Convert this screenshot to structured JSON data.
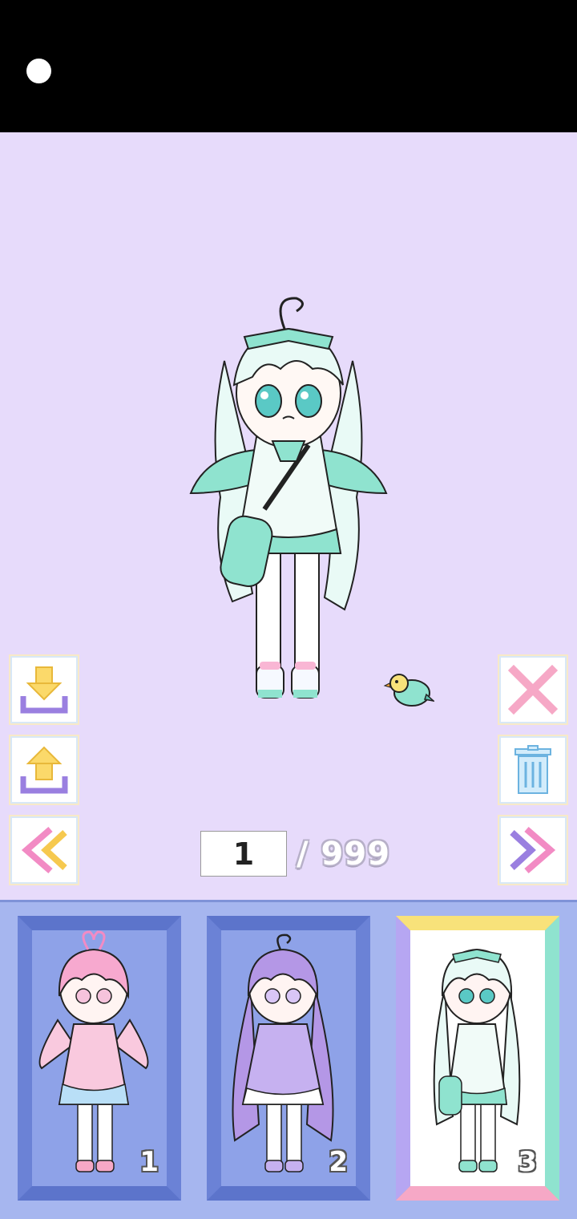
{
  "page": {
    "current": "1",
    "total": "/ 999"
  },
  "slots": [
    {
      "number": "1",
      "hair_color": "#f7a9cf",
      "outfit_color": "#f9c9de",
      "selected": false
    },
    {
      "number": "2",
      "hair_color": "#b497e6",
      "outfit_color": "#c6b1f0",
      "selected": false
    },
    {
      "number": "3",
      "hair_color": "#dff5f0",
      "outfit_color": "#8fe3cf",
      "selected": true
    }
  ],
  "colors": {
    "stage_bg": "#e7dbfb",
    "tray_bg": "#a6b6ef",
    "slot_bg": "#8ea2e8",
    "mint": "#8fe3cf",
    "selected_frame": "#ffffff"
  },
  "icons": {
    "save": "download-tray-icon",
    "load": "upload-tray-icon",
    "prev": "double-chevron-left-icon",
    "close": "x-close-icon",
    "delete": "trash-can-icon",
    "next": "double-chevron-right-icon"
  }
}
